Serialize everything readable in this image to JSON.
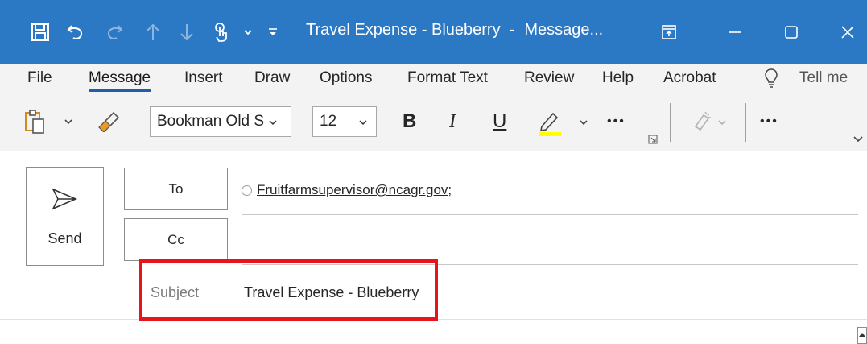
{
  "window": {
    "title_subject": "Travel Expense - Blueberry",
    "title_separator": "-",
    "title_type": "Message...",
    "accent_color": "#2b78c5"
  },
  "menu": {
    "items": [
      "File",
      "Message",
      "Insert",
      "Draw",
      "Options",
      "Format Text",
      "Review",
      "Help",
      "Acrobat"
    ],
    "active": "Message",
    "tell_me": "Tell me"
  },
  "ribbon": {
    "font_name": "Bookman Old S",
    "font_size": "12",
    "bold": "B",
    "italic": "I",
    "underline": "U",
    "more": "•••",
    "highlight_color": "#ffff00"
  },
  "compose": {
    "send_label": "Send",
    "to_label": "To",
    "cc_label": "Cc",
    "to_recipient": "Fruitfarmsupervisor@ncagr.gov",
    "recipient_separator": ";",
    "subject_label": "Subject",
    "subject_value": "Travel Expense - Blueberry",
    "highlight_color": "#e8141d"
  }
}
